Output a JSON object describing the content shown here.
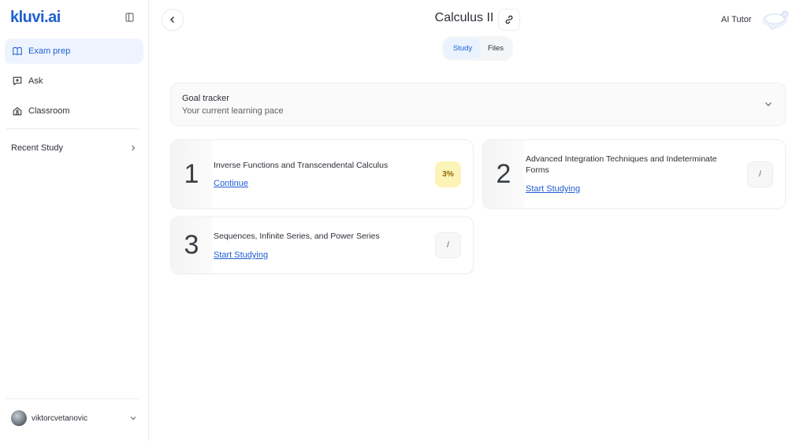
{
  "app": {
    "logo": "kluvi.ai",
    "title": "Calculus II",
    "tutor_label": "AI Tutor"
  },
  "sidebar": {
    "items": [
      {
        "label": "Exam prep",
        "icon": "book-icon",
        "active": true
      },
      {
        "label": "Ask",
        "icon": "chat-plus-icon",
        "active": false
      },
      {
        "label": "Classroom",
        "icon": "school-icon",
        "active": false
      }
    ],
    "recent_label": "Recent Study",
    "user": {
      "name": "viktorcvetanovic"
    }
  },
  "tabs": [
    {
      "label": "Study",
      "active": true
    },
    {
      "label": "Files",
      "active": false
    }
  ],
  "goal_tracker": {
    "title": "Goal tracker",
    "subtitle": "Your current learning pace"
  },
  "units": [
    {
      "number": "1",
      "title": "Inverse Functions and Transcendental Calculus",
      "action": "Continue",
      "progress": "3%"
    },
    {
      "number": "2",
      "title": "Advanced Integration Techniques and Indeterminate Forms",
      "action": "Start Studying",
      "progress": "/"
    },
    {
      "number": "3",
      "title": "Sequences, Infinite Series, and Power Series",
      "action": "Start Studying",
      "progress": "/"
    }
  ],
  "colors": {
    "accent": "#1f5fd1",
    "active_bg": "#eef4ff",
    "progress_badge": "#fcf3b8"
  }
}
